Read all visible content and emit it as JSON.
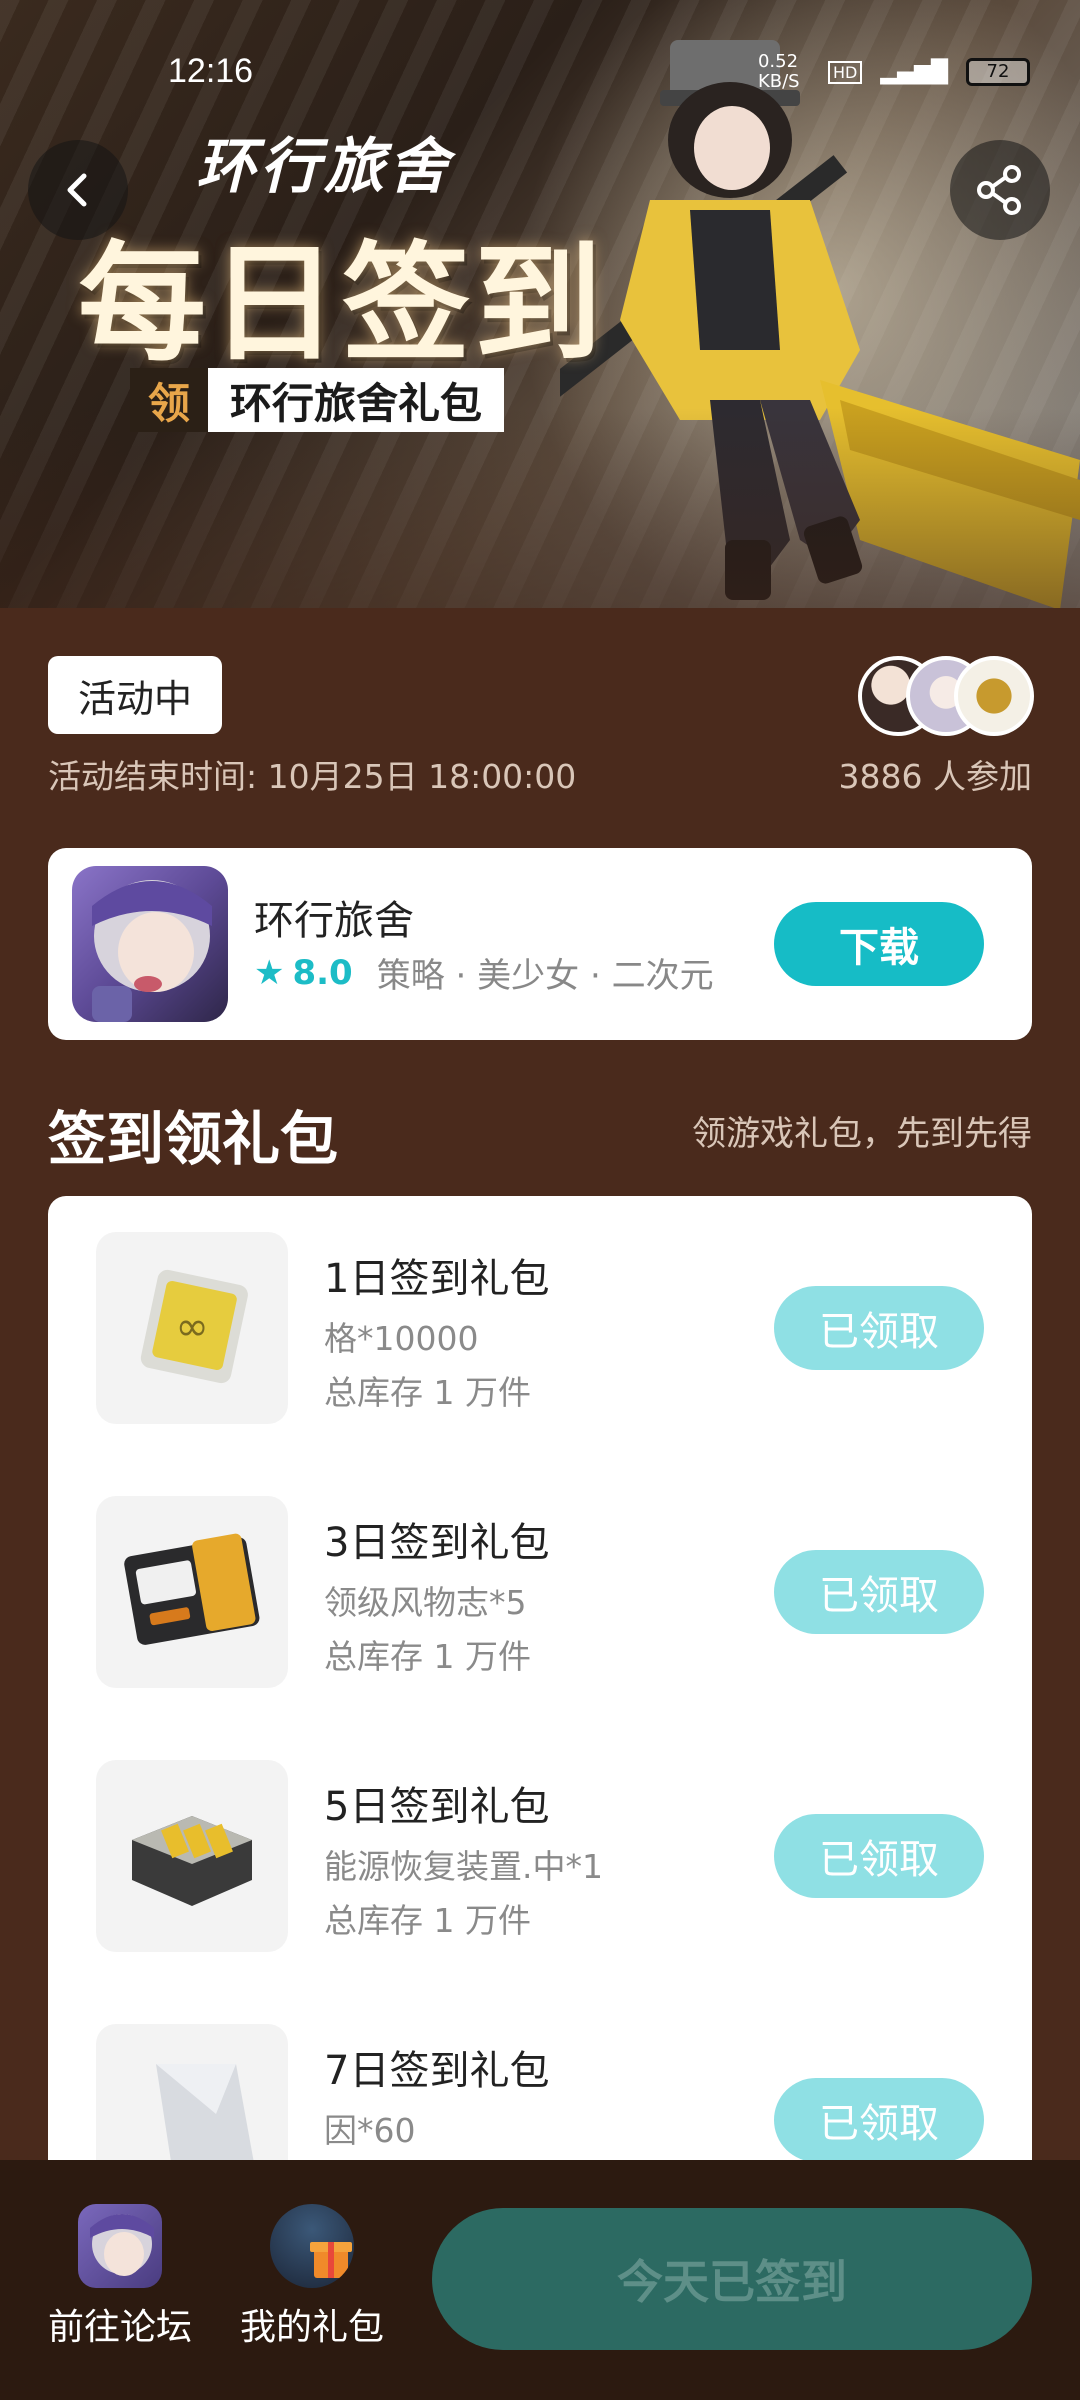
{
  "status_bar": {
    "time": "12:16",
    "network_speed": "0.52 KB/S",
    "battery": "72"
  },
  "hero": {
    "logo": "环行旅舍",
    "title": "每日签到",
    "tag_prefix": "领",
    "tag_name": "环行旅舍礼包"
  },
  "activity": {
    "status": "活动中",
    "end_time": "活动结束时间: 10月25日 18:00:00",
    "participants": "3886 人参加"
  },
  "game": {
    "name": "环行旅舍",
    "rating": "8.0",
    "tags": "策略 · 美少女 · 二次元",
    "download_label": "下载",
    "accent": "#16bcc6"
  },
  "section": {
    "title": "签到领礼包",
    "subtitle": "领游戏礼包，先到先得"
  },
  "gifts": [
    {
      "title": "1日签到礼包",
      "desc": "格*10000",
      "stock": "总库存 1 万件",
      "button": "已领取"
    },
    {
      "title": "3日签到礼包",
      "desc": "领级风物志*5",
      "stock": "总库存 1 万件",
      "button": "已领取"
    },
    {
      "title": "5日签到礼包",
      "desc": "能源恢复装置.中*1",
      "stock": "总库存 1 万件",
      "button": "已领取"
    },
    {
      "title": "7日签到礼包",
      "desc": "因*60",
      "stock": "",
      "button": "已领取"
    }
  ],
  "bottom_bar": {
    "forum_label": "前往论坛",
    "my_gifts_label": "我的礼包",
    "checkin_label": "今天已签到"
  }
}
